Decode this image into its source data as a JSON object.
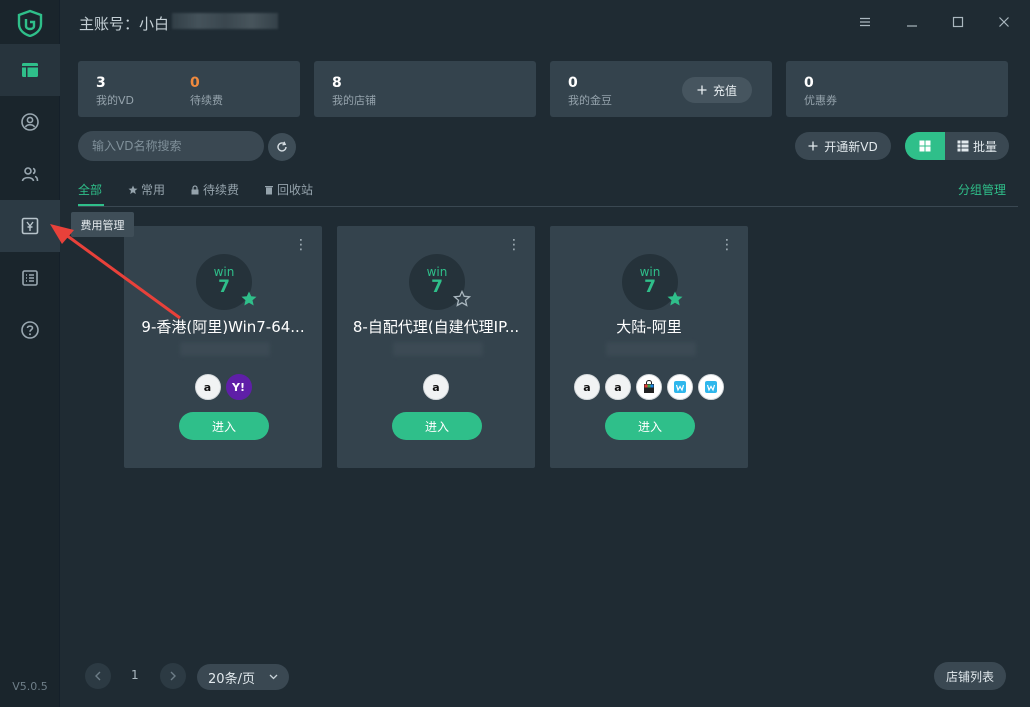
{
  "titlebar": {
    "account_label": "主账号：小白"
  },
  "sidebar": {
    "version": "V5.0.5",
    "items": [
      {
        "name": "vd-list",
        "icon": "window-icon"
      },
      {
        "name": "account",
        "icon": "user-circle-icon"
      },
      {
        "name": "users",
        "icon": "users-icon"
      },
      {
        "name": "fees",
        "icon": "yen-icon"
      },
      {
        "name": "list",
        "icon": "list-icon"
      },
      {
        "name": "help",
        "icon": "help-icon"
      }
    ],
    "tooltip": "费用管理"
  },
  "stats": [
    {
      "value": "3",
      "label": "我的VD"
    },
    {
      "value": "0",
      "label": "待续费"
    },
    {
      "value": "8",
      "label": "我的店铺"
    },
    {
      "value": "0",
      "label": "我的金豆"
    },
    {
      "value": "0",
      "label": "优惠券"
    }
  ],
  "recharge_label": "充值",
  "search": {
    "placeholder": "输入VD名称搜索"
  },
  "new_vd_label": "开通新VD",
  "batch_label": "批量",
  "tabs": [
    {
      "label": "全部"
    },
    {
      "label": "常用"
    },
    {
      "label": "待续费"
    },
    {
      "label": "回收站"
    }
  ],
  "group_manage_label": "分组管理",
  "cards": [
    {
      "os": "win",
      "version": "7",
      "title": "9-香港(阿里)Win7-64...",
      "starred": true,
      "enter_label": "进入"
    },
    {
      "os": "win",
      "version": "7",
      "title": "8-自配代理(自建代理IP...",
      "starred": false,
      "enter_label": "进入"
    },
    {
      "os": "win",
      "version": "7",
      "title": "大陆-阿里",
      "starred": true,
      "enter_label": "进入"
    }
  ],
  "pagination": {
    "current_page": "1",
    "page_size": "20条/页"
  },
  "store_list_label": "店铺列表",
  "colors": {
    "accent": "#2fbf8a",
    "warning": "#f08a3e",
    "background": "#1f2b33",
    "card": "#34434d"
  }
}
